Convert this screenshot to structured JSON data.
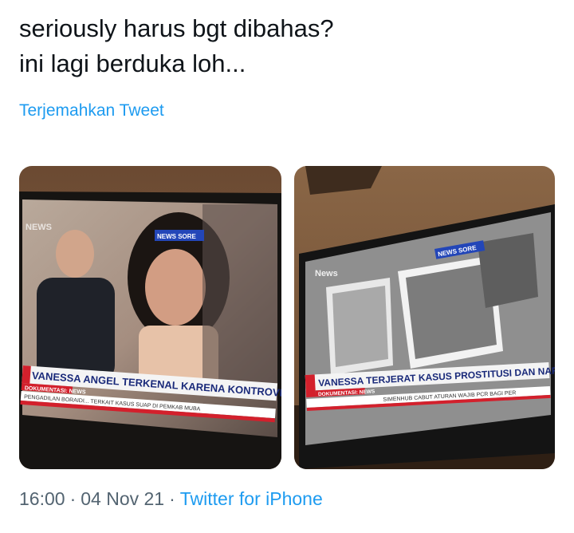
{
  "tweet": {
    "text_lines": [
      "seriously harus bgt dibahas?",
      "ini lagi berduka loh..."
    ],
    "translate_label": "Terjemahkan Tweet",
    "time": "16:00",
    "separator": "·",
    "date": "04 Nov 21",
    "source": "Twitter for iPhone"
  },
  "media": {
    "photo_1": {
      "logo": "NEWS",
      "badge": "NEWS SORE",
      "headline": "VANESSA ANGEL TERKENAL KARENA KONTROVERSI",
      "sub_label": "DOKUMENTASI: NEWS",
      "ticker": "PENGADILAN BORAIDI... TERKAIT KASUS SUAP DI PEMKAB MUBA"
    },
    "photo_2": {
      "logo": "News",
      "badge": "NEWS SORE",
      "headline": "VANESSA TERJERAT KASUS PROSTITUSI DAN NARKOBA",
      "sub_label": "DOKUMENTASI: NEWS",
      "ticker": "SIMENHUB CABUT ATURAN WAJIB PCR BAGI PER"
    }
  },
  "colors": {
    "link": "#1d9bf0",
    "meta": "#536471",
    "text": "#0f1419",
    "news_red": "#d3202c"
  }
}
